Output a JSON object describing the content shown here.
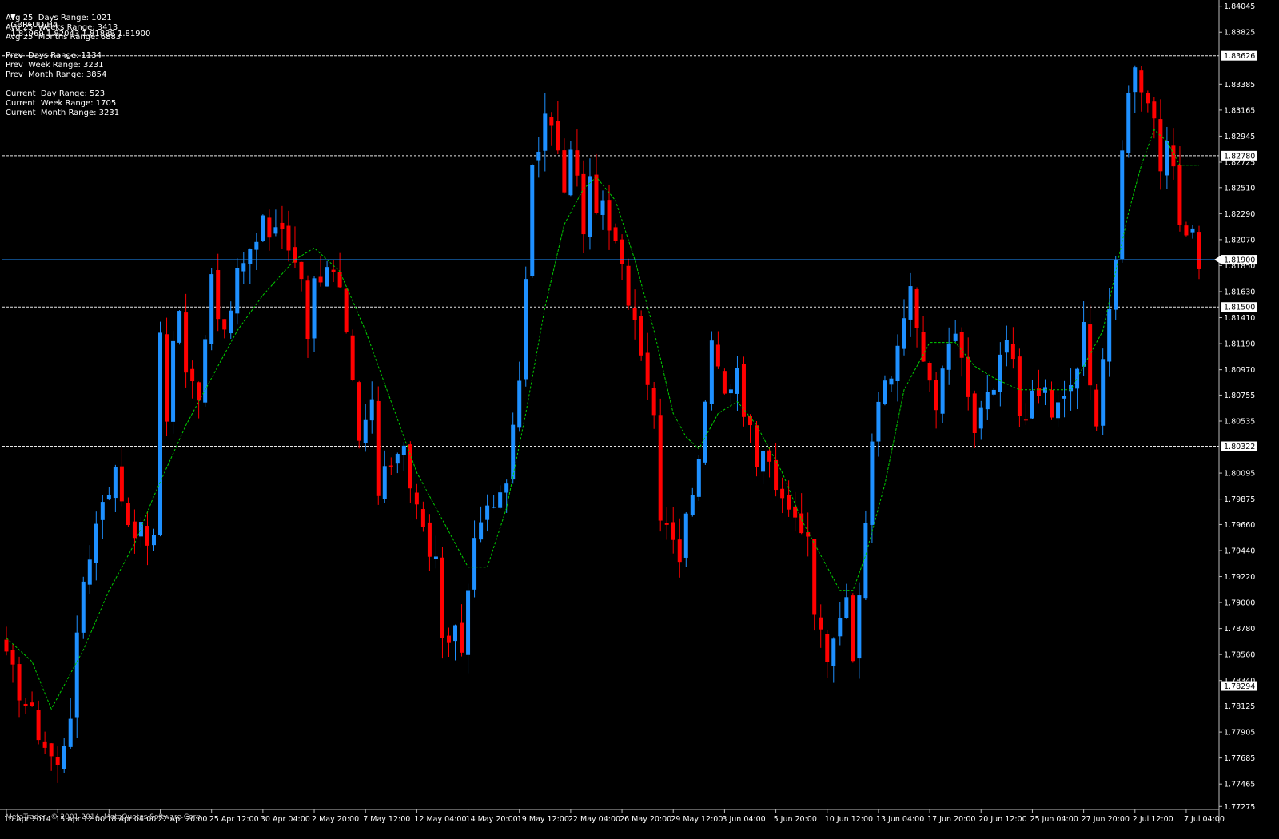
{
  "header": {
    "symbol": "GBPAUD,H4",
    "ohlc": "1.81969 1.82043 1.81888 1.81900",
    "menu_icon": "triangle-down-icon"
  },
  "info_lines": [
    "Avg 25  Days Range: 1021",
    "Avg 25  Weeks Range: 3413",
    "Avg 25  Months Range: 6883",
    "",
    "Prev  Days Range: 1134",
    "Prev  Week Range: 3231",
    "Prev  Month Range: 3854",
    "",
    "Current  Day Range: 523",
    "Current  Week Range: 1705",
    "Current  Month Range: 3231"
  ],
  "copyright": "MetaTrader, © 2001-2014, MetaQuotes Software Corp.",
  "colors": {
    "background": "#000000",
    "bull": "#1e90ff",
    "bear": "#ff0000",
    "ma": "#00d000",
    "price_line": "#1e90ff",
    "levels": "#ffffff",
    "axis_text": "#ffffff"
  },
  "chart_data": {
    "type": "candlestick",
    "ylim": [
      1.7725,
      1.8407
    ],
    "y_ticks": [
      "1.84045",
      "1.83825",
      "1.83385",
      "1.83165",
      "1.82945",
      "1.82725",
      "1.82510",
      "1.82290",
      "1.82070",
      "1.81850",
      "1.81630",
      "1.81410",
      "1.81190",
      "1.80970",
      "1.80755",
      "1.80535",
      "1.80095",
      "1.79875",
      "1.79660",
      "1.79440",
      "1.79220",
      "1.79000",
      "1.78780",
      "1.78560",
      "1.78340",
      "1.78125",
      "1.77905",
      "1.77685",
      "1.77465",
      "1.77275"
    ],
    "x_ticks": [
      "10 Apr 2014",
      "15 Apr 12:00",
      "18 Apr 04:00",
      "22 Apr 20:00",
      "25 Apr 12:00",
      "30 Apr 04:00",
      "2 May 20:00",
      "7 May 12:00",
      "12 May 04:00",
      "14 May 20:00",
      "19 May 12:00",
      "22 May 04:00",
      "26 May 20:00",
      "29 May 12:00",
      "3 Jun 04:00",
      "5 Jun 20:00",
      "10 Jun 12:00",
      "13 Jun 04:00",
      "17 Jun 20:00",
      "20 Jun 12:00",
      "25 Jun 04:00",
      "27 Jun 20:00",
      "2 Jul 12:00",
      "7 Jul 04:00"
    ],
    "horizontal_levels": [
      {
        "label": "1.83626",
        "value": 1.83626
      },
      {
        "label": "1.82780",
        "value": 1.8278
      },
      {
        "label": "1.81500",
        "value": 1.815
      },
      {
        "label": "1.80322",
        "value": 1.80322
      },
      {
        "label": "1.78294",
        "value": 1.78294
      }
    ],
    "current_price": {
      "label": "1.81900",
      "value": 1.819
    },
    "close_path": [
      [
        0,
        1.785
      ],
      [
        6,
        1.778
      ],
      [
        8,
        1.776
      ],
      [
        10,
        1.781
      ],
      [
        12,
        1.792
      ],
      [
        15,
        1.799
      ],
      [
        17,
        1.801
      ],
      [
        19,
        1.797
      ],
      [
        21,
        1.796
      ],
      [
        23,
        1.795
      ],
      [
        24,
        1.813
      ],
      [
        25,
        1.806
      ],
      [
        26,
        1.812
      ],
      [
        27,
        1.815
      ],
      [
        28,
        1.809
      ],
      [
        30,
        1.808
      ],
      [
        32,
        1.818
      ],
      [
        33,
        1.815
      ],
      [
        34,
        1.812
      ],
      [
        36,
        1.818
      ],
      [
        38,
        1.819
      ],
      [
        40,
        1.823
      ],
      [
        41,
        1.821
      ],
      [
        42,
        1.822
      ],
      [
        44,
        1.82
      ],
      [
        46,
        1.818
      ],
      [
        47,
        1.813
      ],
      [
        48,
        1.817
      ],
      [
        50,
        1.819
      ],
      [
        52,
        1.816
      ],
      [
        54,
        1.808
      ],
      [
        55,
        1.803
      ],
      [
        57,
        1.807
      ],
      [
        58,
        1.799
      ],
      [
        60,
        1.802
      ],
      [
        62,
        1.804
      ],
      [
        63,
        1.8
      ],
      [
        65,
        1.796
      ],
      [
        67,
        1.793
      ],
      [
        68,
        1.786
      ],
      [
        70,
        1.788
      ],
      [
        71,
        1.786
      ],
      [
        72,
        1.792
      ],
      [
        74,
        1.797
      ],
      [
        76,
        1.798
      ],
      [
        78,
        1.801
      ],
      [
        80,
        1.808
      ],
      [
        81,
        1.818
      ],
      [
        82,
        1.826
      ],
      [
        83,
        1.829
      ],
      [
        84,
        1.831
      ],
      [
        85,
        1.83
      ],
      [
        86,
        1.828
      ],
      [
        87,
        1.824
      ],
      [
        88,
        1.829
      ],
      [
        90,
        1.822
      ],
      [
        91,
        1.825
      ],
      [
        93,
        1.823
      ],
      [
        95,
        1.82
      ],
      [
        97,
        1.816
      ],
      [
        99,
        1.812
      ],
      [
        101,
        1.806
      ],
      [
        102,
        1.798
      ],
      [
        104,
        1.796
      ],
      [
        105,
        1.794
      ],
      [
        107,
        1.8
      ],
      [
        109,
        1.806
      ],
      [
        110,
        1.812
      ],
      [
        111,
        1.811
      ],
      [
        112,
        1.808
      ],
      [
        114,
        1.81
      ],
      [
        115,
        1.806
      ],
      [
        116,
        1.804
      ],
      [
        117,
        1.801
      ],
      [
        118,
        1.803
      ],
      [
        120,
        1.8
      ],
      [
        121,
        1.798
      ],
      [
        123,
        1.797
      ],
      [
        125,
        1.796
      ],
      [
        126,
        1.79
      ],
      [
        127,
        1.787
      ],
      [
        128,
        1.786
      ],
      [
        129,
        1.788
      ],
      [
        131,
        1.791
      ],
      [
        132,
        1.784
      ],
      [
        134,
        1.797
      ],
      [
        135,
        1.804
      ],
      [
        136,
        1.807
      ],
      [
        138,
        1.809
      ],
      [
        140,
        1.815
      ],
      [
        141,
        1.816
      ],
      [
        142,
        1.813
      ],
      [
        144,
        1.808
      ],
      [
        145,
        1.806
      ],
      [
        146,
        1.81
      ],
      [
        148,
        1.812
      ],
      [
        149,
        1.811
      ],
      [
        151,
        1.804
      ],
      [
        152,
        1.806
      ],
      [
        154,
        1.808
      ],
      [
        156,
        1.812
      ],
      [
        157,
        1.81
      ],
      [
        158,
        1.806
      ],
      [
        160,
        1.807
      ],
      [
        162,
        1.808
      ],
      [
        163,
        1.806
      ],
      [
        165,
        1.807
      ],
      [
        167,
        1.81
      ],
      [
        168,
        1.813
      ],
      [
        169,
        1.808
      ],
      [
        170,
        1.806
      ],
      [
        171,
        1.811
      ],
      [
        172,
        1.815
      ],
      [
        173,
        1.818
      ],
      [
        174,
        1.828
      ],
      [
        175,
        1.834
      ],
      [
        176,
        1.835
      ],
      [
        177,
        1.834
      ],
      [
        178,
        1.833
      ],
      [
        179,
        1.831
      ],
      [
        180,
        1.827
      ],
      [
        181,
        1.828
      ],
      [
        182,
        1.826
      ],
      [
        183,
        1.822
      ],
      [
        184,
        1.82
      ],
      [
        185,
        1.822
      ],
      [
        186,
        1.819
      ]
    ],
    "ma_path": [
      [
        0,
        1.787
      ],
      [
        4,
        1.785
      ],
      [
        7,
        1.781
      ],
      [
        9,
        1.783
      ],
      [
        12,
        1.786
      ],
      [
        16,
        1.791
      ],
      [
        20,
        1.795
      ],
      [
        23,
        1.799
      ],
      [
        28,
        1.805
      ],
      [
        32,
        1.809
      ],
      [
        36,
        1.813
      ],
      [
        40,
        1.816
      ],
      [
        45,
        1.819
      ],
      [
        48,
        1.82
      ],
      [
        52,
        1.818
      ],
      [
        56,
        1.813
      ],
      [
        60,
        1.807
      ],
      [
        64,
        1.801
      ],
      [
        68,
        1.797
      ],
      [
        72,
        1.793
      ],
      [
        75,
        1.793
      ],
      [
        78,
        1.798
      ],
      [
        81,
        1.806
      ],
      [
        84,
        1.815
      ],
      [
        87,
        1.822
      ],
      [
        90,
        1.825
      ],
      [
        92,
        1.826
      ],
      [
        95,
        1.824
      ],
      [
        98,
        1.819
      ],
      [
        101,
        1.813
      ],
      [
        104,
        1.806
      ],
      [
        106,
        1.804
      ],
      [
        108,
        1.803
      ],
      [
        111,
        1.806
      ],
      [
        114,
        1.807
      ],
      [
        117,
        1.805
      ],
      [
        121,
        1.801
      ],
      [
        124,
        1.797
      ],
      [
        127,
        1.794
      ],
      [
        130,
        1.791
      ],
      [
        132,
        1.791
      ],
      [
        134,
        1.794
      ],
      [
        137,
        1.8
      ],
      [
        140,
        1.808
      ],
      [
        144,
        1.812
      ],
      [
        148,
        1.812
      ],
      [
        151,
        1.81
      ],
      [
        154,
        1.809
      ],
      [
        158,
        1.808
      ],
      [
        162,
        1.808
      ],
      [
        166,
        1.808
      ],
      [
        169,
        1.811
      ],
      [
        171,
        1.813
      ],
      [
        173,
        1.818
      ],
      [
        175,
        1.823
      ],
      [
        177,
        1.827
      ],
      [
        179,
        1.83
      ],
      [
        181,
        1.829
      ],
      [
        183,
        1.827
      ]
    ]
  }
}
